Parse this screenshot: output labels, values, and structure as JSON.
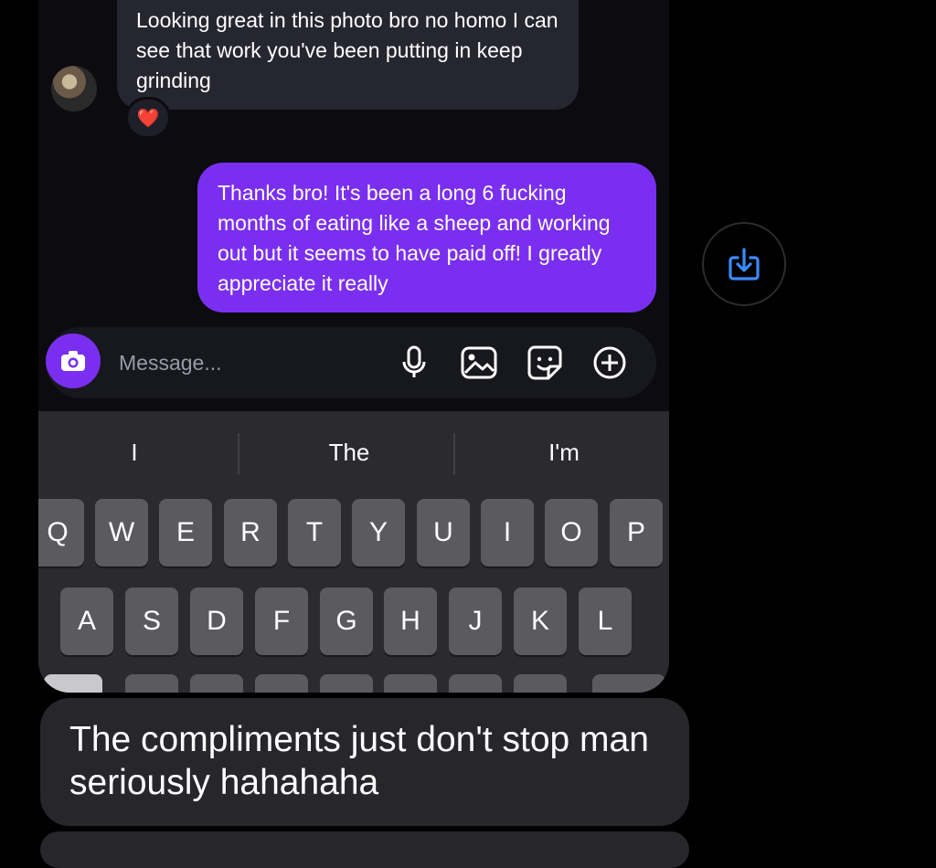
{
  "chat": {
    "incoming_message": "Looking great in this photo bro no homo I can see that work you've been putting in keep grinding",
    "incoming_reaction": "❤️",
    "outgoing_message": "Thanks bro! It's been a long 6 fucking months of eating like a sheep and working out but it seems to have paid off! I greatly appreciate it really"
  },
  "composer": {
    "placeholder": "Message...",
    "icons": [
      "camera-icon",
      "microphone-icon",
      "image-icon",
      "sticker-icon",
      "plus-icon"
    ]
  },
  "keyboard": {
    "suggestions": [
      "I",
      "The",
      "I'm"
    ],
    "row1": [
      "Q",
      "W",
      "E",
      "R",
      "T",
      "Y",
      "U",
      "I",
      "O",
      "P"
    ],
    "row2": [
      "A",
      "S",
      "D",
      "F",
      "G",
      "H",
      "J",
      "K",
      "L"
    ]
  },
  "side_action": {
    "icon": "save-download-icon"
  },
  "caption": {
    "text": "The compliments just don't stop man seriously hahahaha"
  },
  "colors": {
    "accent": "#7a2ff0",
    "incoming_bubble": "#262631",
    "keyboard_bg": "#2b2b2f",
    "key_bg": "#5a5a5f"
  }
}
